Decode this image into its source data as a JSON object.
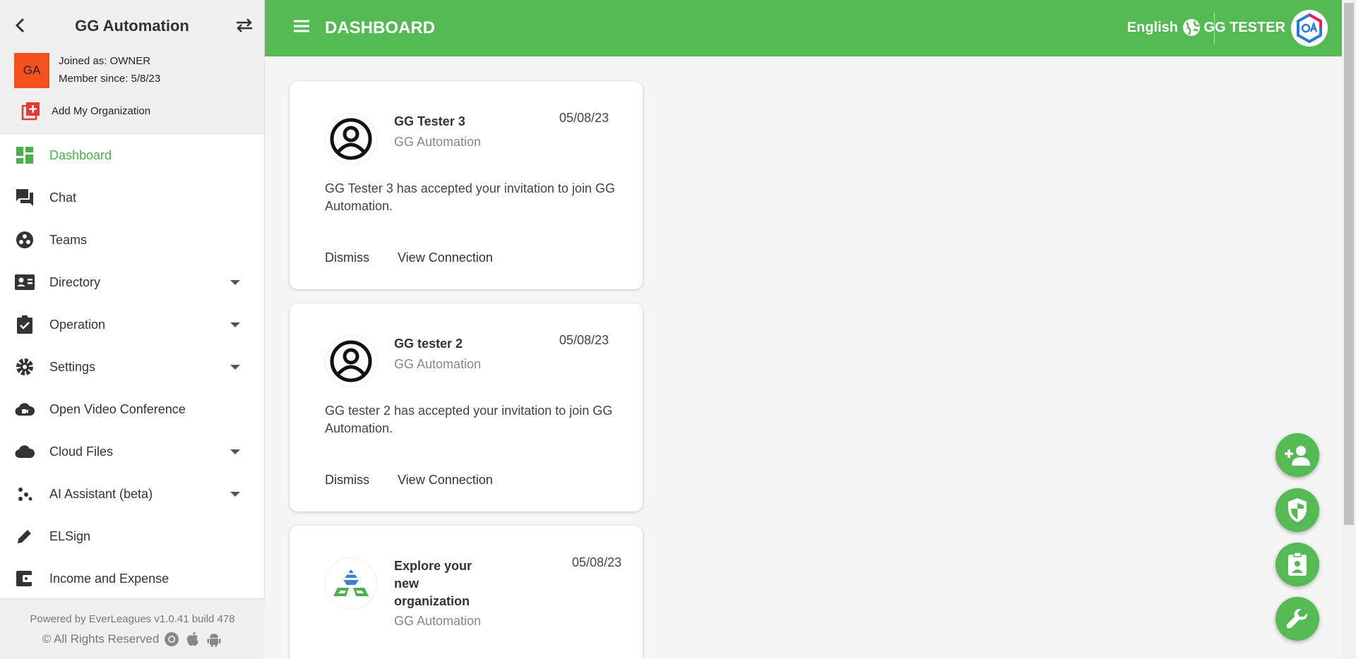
{
  "sidebar": {
    "org_name": "GG Automation",
    "avatar_initials": "GA",
    "joined": "Joined as: OWNER",
    "member_since": "Member since: 5/8/23",
    "add_org": "Add My Organization",
    "items": [
      {
        "label": "Dashboard",
        "icon": "dashboard-icon",
        "active": true
      },
      {
        "label": "Chat",
        "icon": "chat-icon"
      },
      {
        "label": "Teams",
        "icon": "teams-icon"
      },
      {
        "label": "Directory",
        "icon": "contacts-icon",
        "expandable": true
      },
      {
        "label": "Operation",
        "icon": "clipboard-check-icon",
        "expandable": true
      },
      {
        "label": "Settings",
        "icon": "gear-icon",
        "expandable": true
      },
      {
        "label": "Open Video Conference",
        "icon": "cloud-video-icon"
      },
      {
        "label": "Cloud Files",
        "icon": "cloud-icon",
        "expandable": true
      },
      {
        "label": "AI Assistant (beta)",
        "icon": "dots-icon",
        "expandable": true
      },
      {
        "label": "ELSign",
        "icon": "pen-icon"
      },
      {
        "label": "Income and Expense",
        "icon": "wallet-icon"
      }
    ],
    "powered": "Powered by EverLeagues v1.0.41 build 478",
    "rights": "© All Rights Reserved"
  },
  "topbar": {
    "title": "DASHBOARD",
    "language": "English",
    "user": "GG TESTER"
  },
  "cards": [
    {
      "name": "GG Tester 3",
      "org": "GG Automation",
      "date": "05/08/23",
      "message": "GG Tester 3 has accepted your invitation to join GG Automation.",
      "dismiss": "Dismiss",
      "view": "View Connection"
    },
    {
      "name": "GG tester 2",
      "org": "GG Automation",
      "date": "05/08/23",
      "message": "GG tester 2 has accepted your invitation to join GG Automation.",
      "dismiss": "Dismiss",
      "view": "View Connection"
    },
    {
      "name": "Explore your new organization",
      "org": "GG Automation",
      "date": "05/08/23"
    }
  ],
  "colors": {
    "brand_green": "#55b954",
    "avatar_orange": "#f4511e",
    "add_red": "#e53935"
  }
}
